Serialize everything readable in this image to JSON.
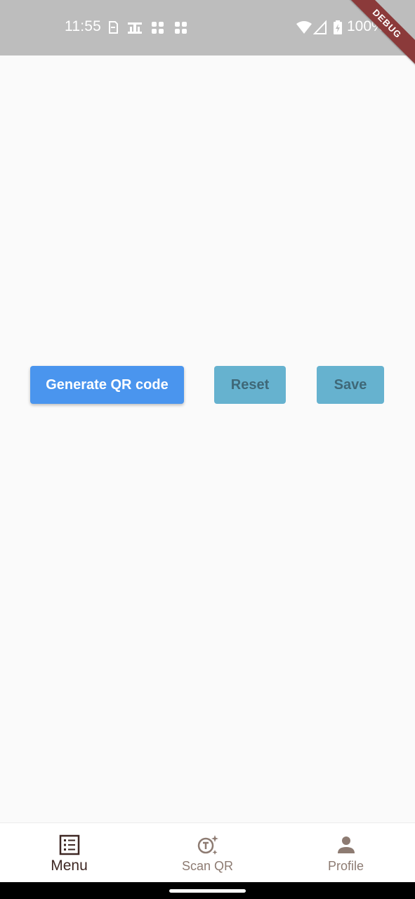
{
  "status_bar": {
    "time": "11:55",
    "battery": "100%",
    "left_icons": [
      "sim-icon",
      "input-icon",
      "app-grid-icon",
      "app-grid-icon"
    ],
    "right_icons": [
      "wifi-icon",
      "signal-icon",
      "battery-icon"
    ]
  },
  "debug_banner": "DEBUG",
  "actions": {
    "generate_label": "Generate QR code",
    "reset_label": "Reset",
    "save_label": "Save"
  },
  "bottom_nav": {
    "items": [
      {
        "label": "Menu",
        "icon": "menu-list-icon",
        "active": true
      },
      {
        "label": "Scan QR",
        "icon": "scan-qr-icon",
        "active": false
      },
      {
        "label": "Profile",
        "icon": "person-icon",
        "active": false
      }
    ]
  },
  "colors": {
    "status_bar": "#bdbdbd",
    "primary_button": "#4a95ee",
    "secondary_button": "#66b2cf",
    "nav_active": "#3e2723",
    "nav_inactive": "#8d7b72",
    "debug": "#8b3a3a"
  }
}
